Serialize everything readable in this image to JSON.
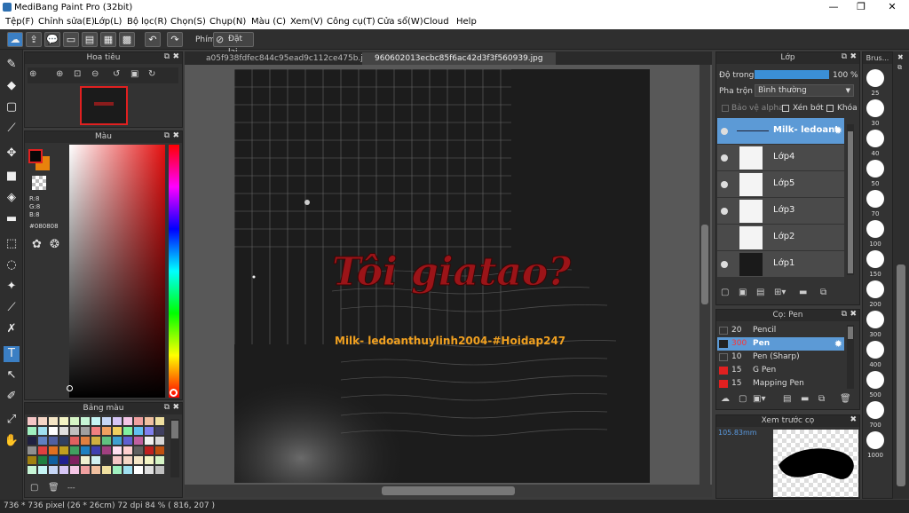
{
  "window": {
    "title": "MediBang Paint Pro (32bit)",
    "minimize": "—",
    "maximize": "❐",
    "close": "✕"
  },
  "menu": [
    "Tệp(F)",
    "Chỉnh sửa(E)",
    "Lớp(L)",
    "Bộ lọc(R)",
    "Chọn(S)",
    "Chụp(N)",
    "Màu (C)",
    "Xem(V)",
    "Công cụ(T)",
    "Cửa sổ(W)",
    "Cloud",
    "Help"
  ],
  "toolbar": {
    "snap_label": "Phím",
    "reset_label": "Đặt lại"
  },
  "tabs": [
    "a05f938fdfec844c95ead9c112ce475b.jpg",
    "960602013ecbc85f6ac42d3f3f560939.jpg"
  ],
  "navigator": {
    "title": "Hoa tiêu"
  },
  "color": {
    "title": "Màu",
    "r": "R:8",
    "g": "G:8",
    "b": "B:8",
    "hex": "#080808"
  },
  "palette": {
    "title": "Bảng màu",
    "footer": "---"
  },
  "layer_panel": {
    "title": "Lớp",
    "opacity_label": "Độ trong",
    "opacity_value": "100 %",
    "blend_label": "Pha trộn",
    "blend_value": "Bình thường",
    "protect_alpha": "Bảo vệ alpha",
    "clipping": "Xén bớt",
    "lock": "Khóa",
    "layers": [
      {
        "name": "Milk- ledoant"
      },
      {
        "name": "Lớp4"
      },
      {
        "name": "Lớp5"
      },
      {
        "name": "Lớp3"
      },
      {
        "name": "Lớp2"
      },
      {
        "name": "Lớp1"
      }
    ]
  },
  "brush_panel": {
    "title": "Cọ: Pen",
    "items": [
      {
        "size": "20",
        "name": "Pencil"
      },
      {
        "size": "300",
        "name": "Pen"
      },
      {
        "size": "10",
        "name": "Pen (Sharp)"
      },
      {
        "size": "15",
        "name": "G Pen"
      },
      {
        "size": "15",
        "name": "Mapping Pen"
      }
    ]
  },
  "preview": {
    "title": "Xem trước cọ",
    "size": "105.83mm"
  },
  "brush_sizes": {
    "title": "Brus...",
    "sizes": [
      "25",
      "30",
      "40",
      "50",
      "70",
      "100",
      "150",
      "200",
      "300",
      "400",
      "500",
      "700",
      "1000"
    ]
  },
  "artwork": {
    "title": "Tôi giatao?",
    "subtitle": "Milk- ledoanthuylinh2004-#Hoidap247"
  },
  "status": "736 * 736 pixel   (26 * 26cm)   72 dpi   84 %   ( 816, 207 )"
}
